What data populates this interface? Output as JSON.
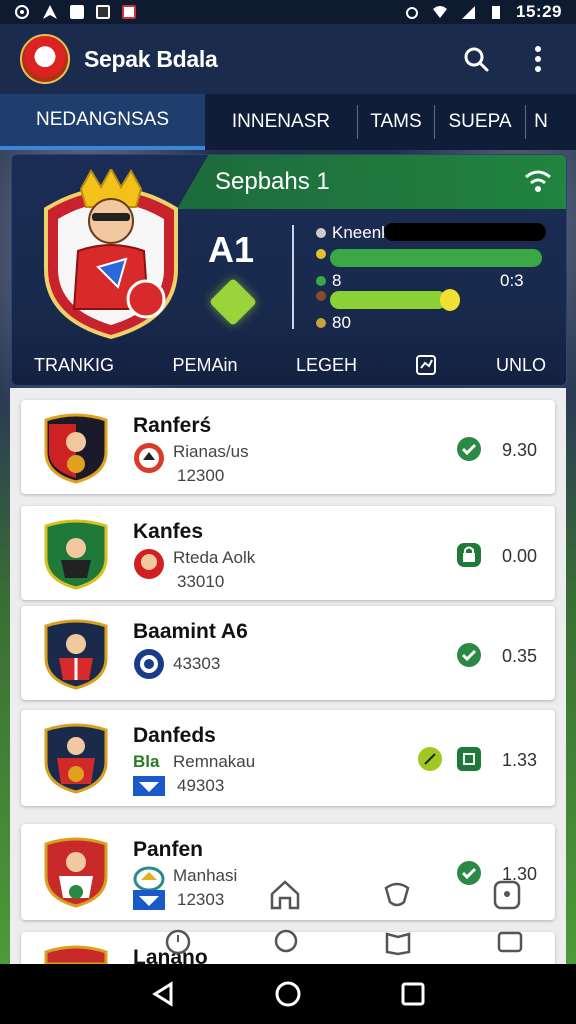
{
  "status_bar": {
    "time": "15:29"
  },
  "app": {
    "title": "Sepak Bdala"
  },
  "tabs": [
    {
      "label": "NEDANGNSAS",
      "active": true
    },
    {
      "label": "INNENASR",
      "active": false
    },
    {
      "label": "TAMS",
      "active": false
    },
    {
      "label": "SUEPA",
      "active": false
    },
    {
      "label": "N",
      "active": false
    }
  ],
  "hero": {
    "banner_title": "Sepbahs 1",
    "score": "A1",
    "stats": [
      {
        "label": "Kneenk",
        "value": "",
        "fill": 0.0,
        "color": "#1a1a1a"
      },
      {
        "label": "",
        "value": "",
        "fill": 1.0,
        "color": "#3aa844"
      },
      {
        "label": "8",
        "value": "0:3",
        "fill": 0.0,
        "color": "#3aa844"
      },
      {
        "label": "",
        "value": "",
        "fill": 0.55,
        "color": "#8cd136"
      },
      {
        "label": "80",
        "value": "",
        "fill": 0.0,
        "color": "#8cd136"
      }
    ],
    "nav": [
      "TRANKIG",
      "PEMAin",
      "LEGEH",
      "",
      "UNLO"
    ]
  },
  "players": [
    {
      "name": "Ranferś",
      "sub": "Rianas/us",
      "num": "12300",
      "value": "9.30",
      "status": "check"
    },
    {
      "name": "Kanfes",
      "sub": "Rteda Aolk",
      "num": "33010",
      "value": "0.00",
      "status": "lock"
    },
    {
      "name": "Baamint A6",
      "sub": "",
      "num": "43303",
      "value": "0.35",
      "status": "check"
    },
    {
      "name": "Danfeds",
      "sub": "Remnakau",
      "num": "49303",
      "value": "1.33",
      "status": "dual",
      "tag": "Bla"
    },
    {
      "name": "Panfen",
      "sub": "Manhasi",
      "num": "12303",
      "value": "1.30",
      "status": "check"
    },
    {
      "name": "Lanano",
      "sub": "",
      "num": "",
      "value": "",
      "status": ""
    }
  ],
  "colors": {
    "accent": "#2f7d3a",
    "nav_blue": "#1a2b4d",
    "tab_active": "#1e3e6e"
  }
}
